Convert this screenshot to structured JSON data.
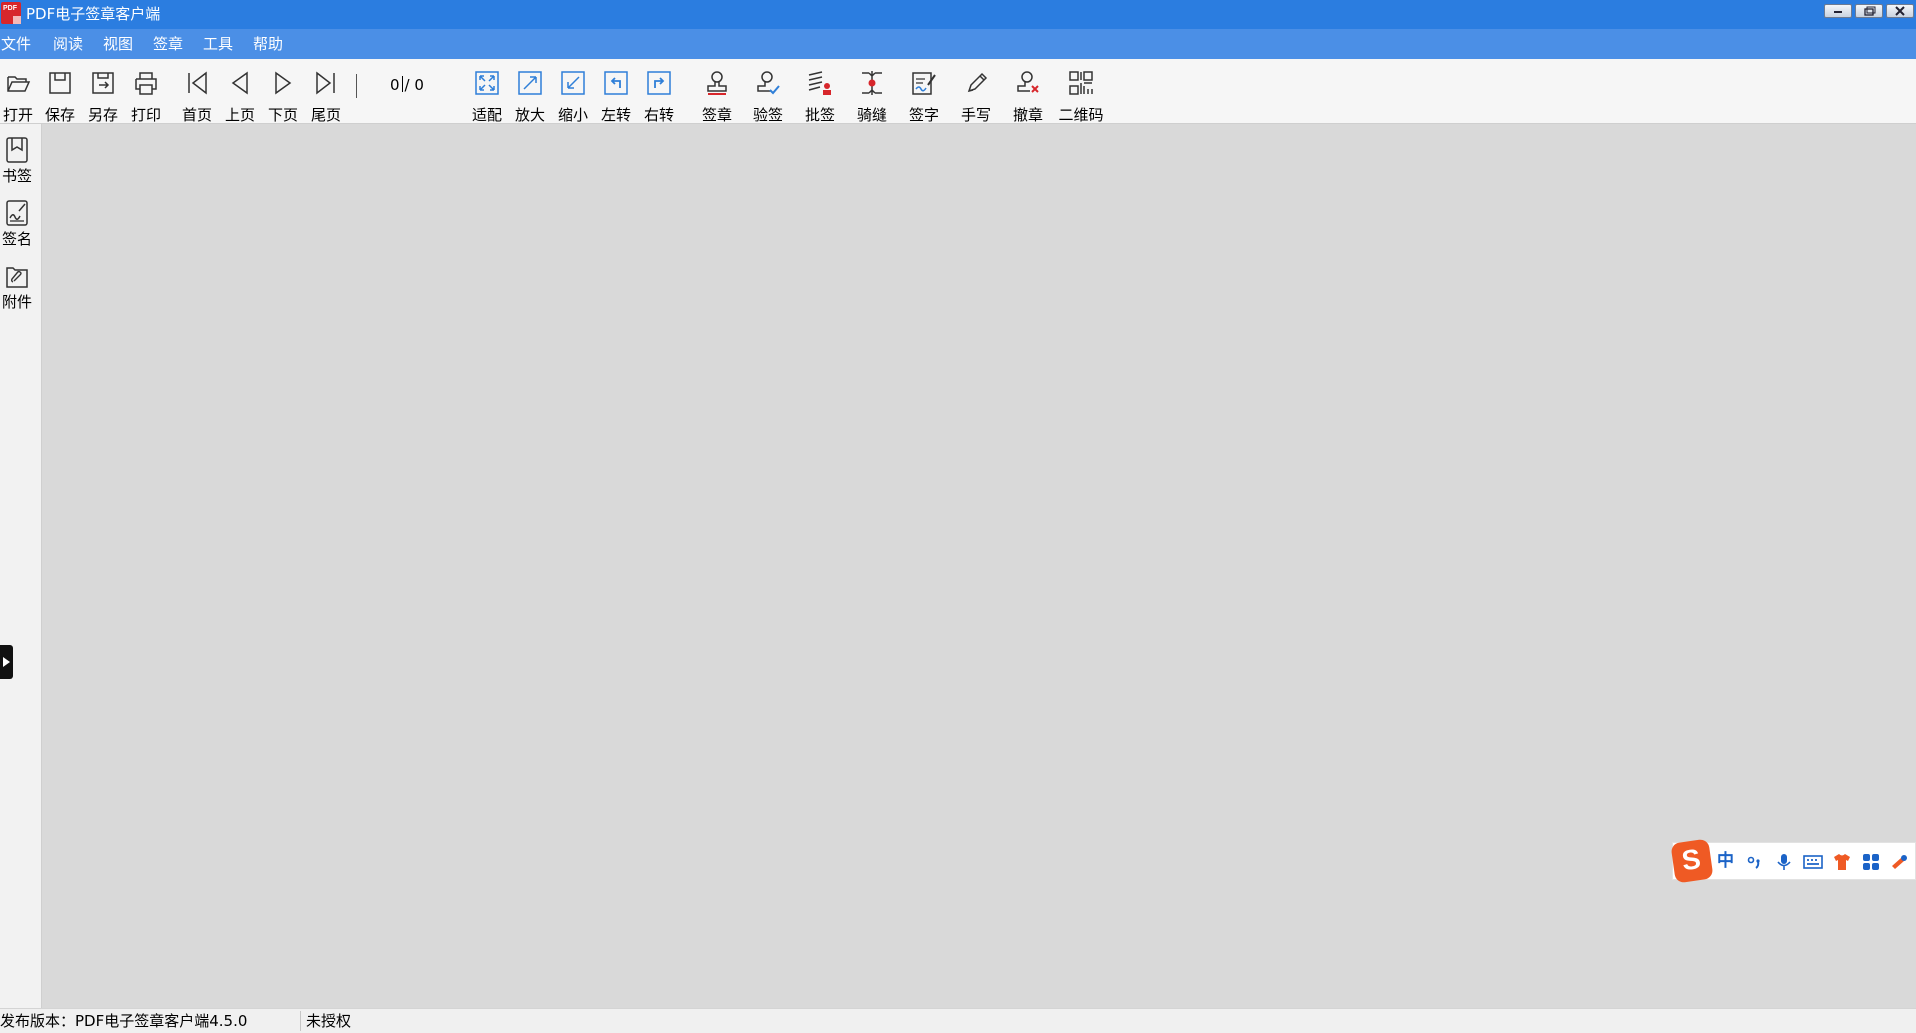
{
  "window": {
    "title": "PDF电子签章客户端",
    "icon": "pdf-app-icon",
    "controls": [
      "minimize",
      "restore",
      "close"
    ]
  },
  "menu": [
    "文件",
    "阅读",
    "视图",
    "签章",
    "工具",
    "帮助"
  ],
  "toolbar": {
    "file": [
      {
        "label": "打开",
        "icon": "open-folder-icon"
      },
      {
        "label": "保存",
        "icon": "save-icon"
      },
      {
        "label": "另存",
        "icon": "save-as-icon"
      },
      {
        "label": "打印",
        "icon": "printer-icon"
      }
    ],
    "nav": [
      {
        "label": "首页",
        "icon": "first-page-icon"
      },
      {
        "label": "上页",
        "icon": "previous-page-icon"
      },
      {
        "label": "下页",
        "icon": "next-page-icon"
      },
      {
        "label": "尾页",
        "icon": "last-page-icon"
      }
    ],
    "page_current": "0",
    "page_total": "/ 0",
    "view": [
      {
        "label": "适配",
        "icon": "fit-page-icon"
      },
      {
        "label": "放大",
        "icon": "zoom-in-icon"
      },
      {
        "label": "缩小",
        "icon": "zoom-out-icon"
      },
      {
        "label": "左转",
        "icon": "rotate-left-icon"
      },
      {
        "label": "右转",
        "icon": "rotate-right-icon"
      }
    ],
    "sign": [
      {
        "label": "签章",
        "icon": "stamp-icon"
      },
      {
        "label": "验签",
        "icon": "verify-signature-icon"
      },
      {
        "label": "批签",
        "icon": "batch-sign-icon"
      },
      {
        "label": "骑缝",
        "icon": "seam-stamp-icon"
      },
      {
        "label": "签字",
        "icon": "sign-text-icon"
      },
      {
        "label": "手写",
        "icon": "handwrite-pen-icon"
      },
      {
        "label": "撤章",
        "icon": "revoke-stamp-icon"
      },
      {
        "label": "二维码",
        "icon": "qrcode-icon"
      }
    ]
  },
  "sidebar": [
    {
      "label": "书签",
      "icon": "bookmark-icon"
    },
    {
      "label": "签名",
      "icon": "signature-icon"
    },
    {
      "label": "附件",
      "icon": "attachment-icon"
    }
  ],
  "status": {
    "version": "发布版本：PDF电子签章客户端4.5.0",
    "license": "未授权"
  },
  "ime": {
    "logo": "S",
    "mode": "中",
    "icons": [
      "punctuation-icon",
      "microphone-icon",
      "keyboard-icon",
      "skin-icon",
      "toolbox-icon",
      "settings-icon"
    ]
  },
  "colors": {
    "titlebar": "#2b7de0",
    "menubar": "#4b8fe6",
    "canvas": "#d9d9d9",
    "icon_blue": "#2f7fd8",
    "accent_red": "#d7262b"
  }
}
